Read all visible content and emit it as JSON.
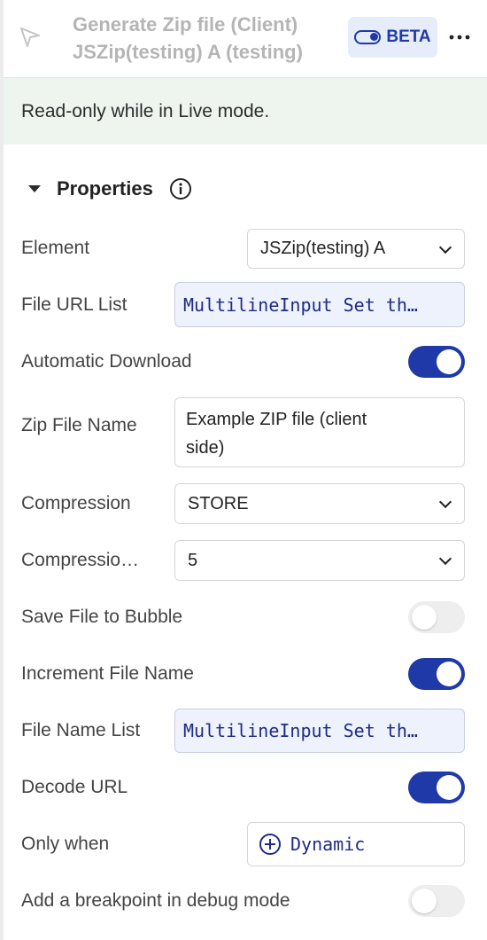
{
  "header": {
    "title_line1": "Generate Zip file (Client)",
    "title_line2": "JSZip(testing) A (testing)",
    "badge": "BETA"
  },
  "banner": "Read-only while in Live mode.",
  "section": {
    "title": "Properties"
  },
  "fields": {
    "element": {
      "label": "Element",
      "value": "JSZip(testing) A"
    },
    "file_url_list": {
      "label": "File URL List",
      "value": "MultilineInput Set th…"
    },
    "automatic_download": {
      "label": "Automatic Download",
      "on": true
    },
    "zip_file_name": {
      "label": "Zip File Name",
      "value_line1": "Example ZIP file (client",
      "value_line2": "side)"
    },
    "compression": {
      "label": "Compression",
      "value": "STORE"
    },
    "compression_level": {
      "label": "Compressio…",
      "value": "5"
    },
    "save_file_to_bubble": {
      "label": "Save File to Bubble",
      "on": false
    },
    "increment_file_name": {
      "label": "Increment File Name",
      "on": true
    },
    "file_name_list": {
      "label": "File Name List",
      "value": "MultilineInput Set th…"
    },
    "decode_url": {
      "label": "Decode URL",
      "on": true
    },
    "only_when": {
      "label": "Only when",
      "value": "Dynamic"
    },
    "breakpoint": {
      "label": "Add a breakpoint in debug mode",
      "on": false
    }
  },
  "colors": {
    "accent": "#1f3aa8",
    "banner_bg": "#eef5ef",
    "code_bg": "#eef2fc"
  }
}
